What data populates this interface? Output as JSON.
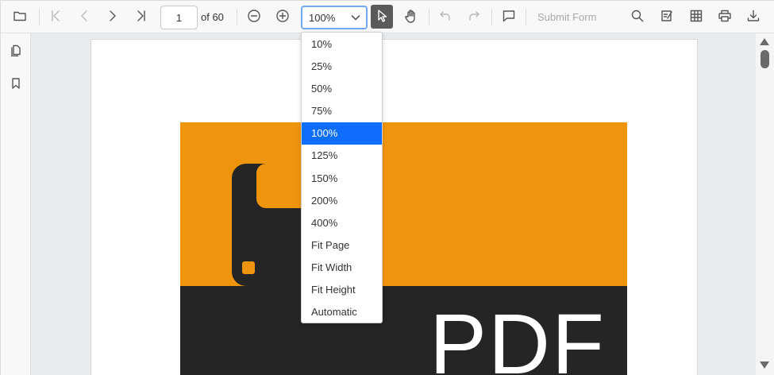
{
  "toolbar": {
    "page_number": "1",
    "page_of": "of 60",
    "zoom_value": "100%",
    "submit_form_label": "Submit Form"
  },
  "zoom_dropdown": {
    "options": [
      "10%",
      "25%",
      "50%",
      "75%",
      "100%",
      "125%",
      "150%",
      "200%",
      "400%",
      "Fit Page",
      "Fit Width",
      "Fit Height",
      "Automatic"
    ],
    "selected": "100%"
  },
  "document": {
    "cover_text": "PDF"
  },
  "colors": {
    "accent": "#0d6efd",
    "cover_orange": "#ef950d",
    "cover_dark": "#252525",
    "active_tool": "#5a5a5a"
  },
  "icons": [
    "open-file-icon",
    "first-page-icon",
    "previous-page-icon",
    "next-page-icon",
    "last-page-icon",
    "zoom-out-icon",
    "zoom-in-icon",
    "chevron-down-icon",
    "selection-tool-icon",
    "pan-tool-icon",
    "undo-icon",
    "redo-icon",
    "comment-icon",
    "search-icon",
    "annotation-icon",
    "form-designer-icon",
    "print-icon",
    "download-icon",
    "page-thumbnails-icon",
    "bookmark-icon"
  ]
}
